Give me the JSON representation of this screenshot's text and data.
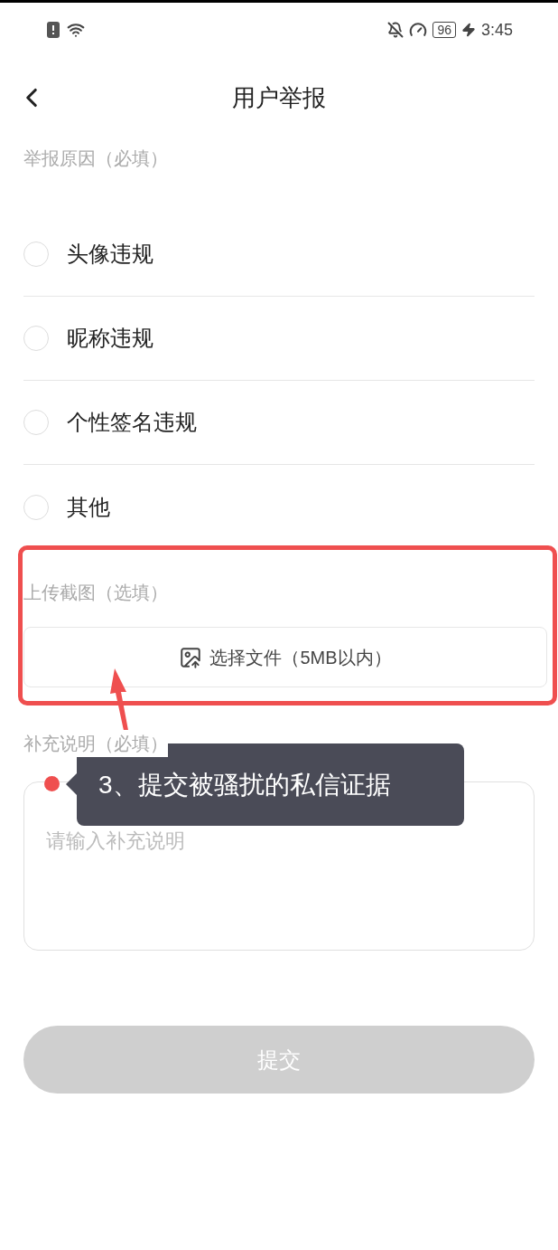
{
  "status_bar": {
    "battery": "96",
    "time": "3:45"
  },
  "header": {
    "title": "用户举报"
  },
  "reason_section": {
    "label": "举报原因（必填）",
    "options": [
      {
        "label": "头像违规",
        "selected": false
      },
      {
        "label": "昵称违规",
        "selected": false
      },
      {
        "label": "个性签名违规",
        "selected": false
      },
      {
        "label": "其他",
        "selected": false
      }
    ]
  },
  "upload_section": {
    "label": "上传截图（选填）",
    "button": "选择文件（5MB以内）"
  },
  "note_section": {
    "label": "补充说明（必填）",
    "placeholder": "请输入补充说明"
  },
  "submit": {
    "label": "提交",
    "disabled": true
  },
  "annotation": {
    "text": "3、提交被骚扰的私信证据"
  }
}
